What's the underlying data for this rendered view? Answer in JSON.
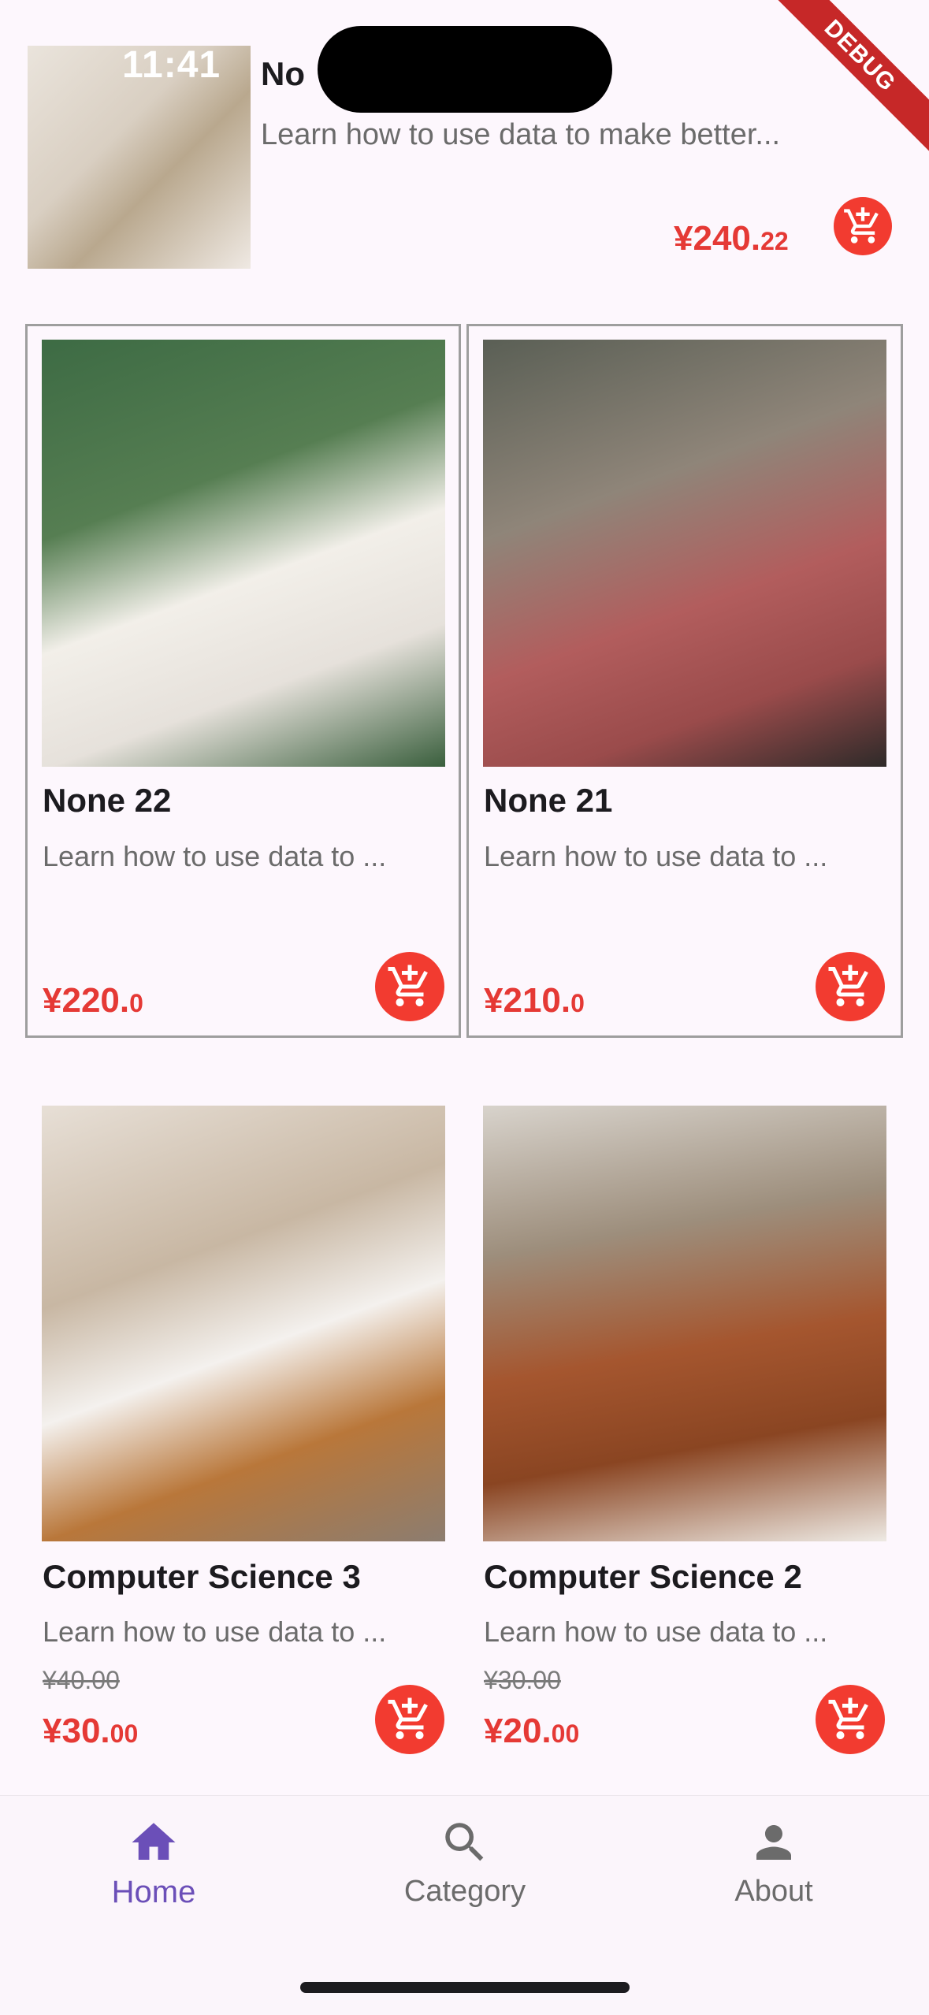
{
  "status_bar": {
    "time": "11:41",
    "debug_label": "DEBUG"
  },
  "top_item": {
    "title": "No",
    "description": "Learn how to use data to make better...",
    "price_main": "¥240.",
    "price_cents": "22"
  },
  "cards": [
    {
      "title": "None 22",
      "description": "Learn how to use data to ...",
      "price_main": "¥220.",
      "price_cents": "0",
      "old_price": ""
    },
    {
      "title": "None 21",
      "description": "Learn how to use data to ...",
      "price_main": "¥210.",
      "price_cents": "0",
      "old_price": ""
    },
    {
      "title": "Computer Science 3",
      "description": "Learn how to use data to ...",
      "price_main": "¥30.",
      "price_cents": "00",
      "old_price": "¥40.00"
    },
    {
      "title": "Computer Science 2",
      "description": "Learn how to use data to ...",
      "price_main": "¥20.",
      "price_cents": "00",
      "old_price": "¥30.00"
    }
  ],
  "bottom_nav": {
    "items": [
      {
        "label": "Home",
        "icon": "home-icon",
        "active": true
      },
      {
        "label": "Category",
        "icon": "search-icon",
        "active": false
      },
      {
        "label": "About",
        "icon": "person-icon",
        "active": false
      }
    ]
  },
  "colors": {
    "accent": "#6b4fb8",
    "price": "#e53935",
    "cart": "#f23b30"
  }
}
